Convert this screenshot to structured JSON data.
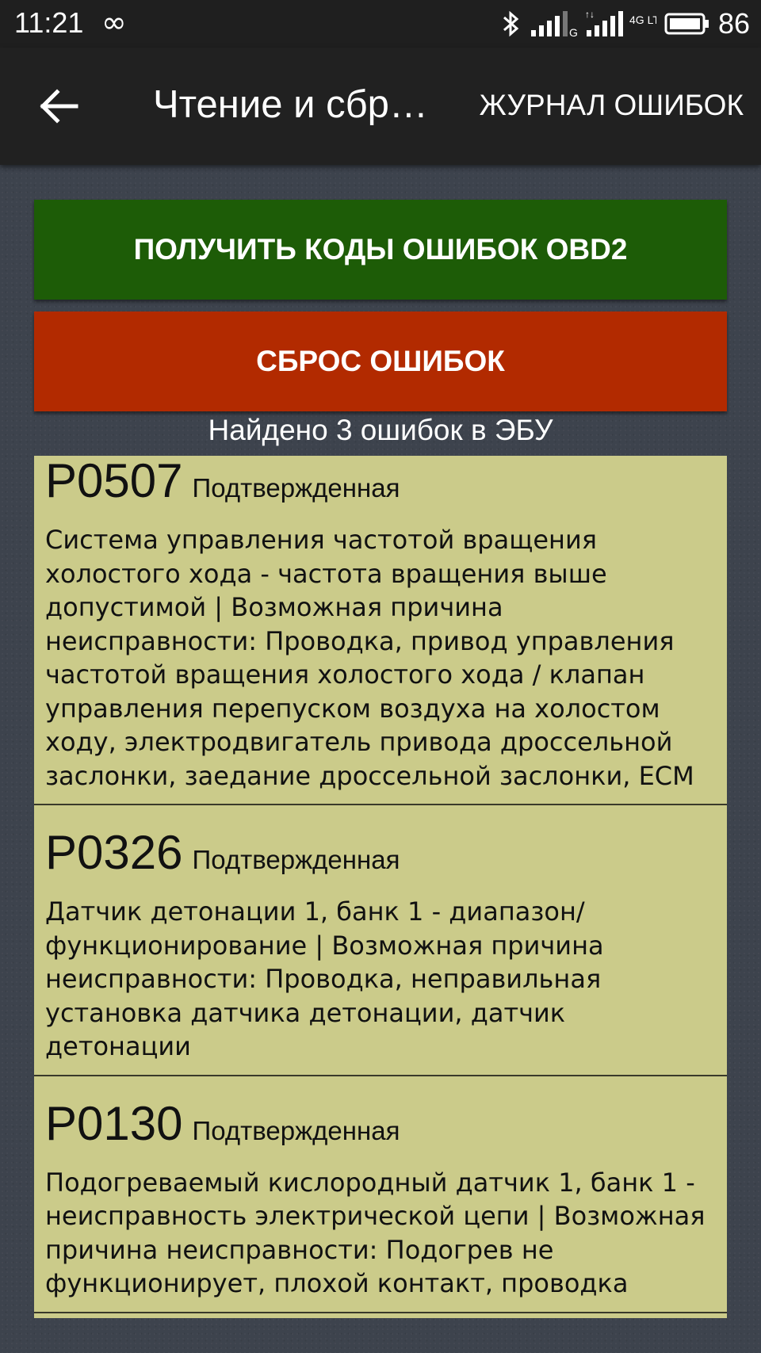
{
  "status_bar": {
    "time": "11:21",
    "infinity_symbol": "∞",
    "network": "4G LTE",
    "battery": "86"
  },
  "app_bar": {
    "title": "Чтение и сбр…",
    "log_label": "ЖУРНАЛ ОШИБОК"
  },
  "actions": {
    "get_codes_label": "ПОЛУЧИТЬ КОДЫ ОШИБОК OBD2",
    "reset_label": "СБРОС ОШИБОК"
  },
  "summary": "Найдено 3 ошибок в ЭБУ",
  "errors": [
    {
      "code": "P0507",
      "status": "Подтвержденная",
      "description": "Система управления частотой вращения холостого хода - частота вращения выше допустимой | Возможная причина неисправности: Проводка, привод управления частотой вращения холостого хода / клапан управления перепуском воздуха на холостом ходу, электродвигатель привода дроссельной заслонки, заедание дроссельной заслонки, ECM"
    },
    {
      "code": "P0326",
      "status": "Подтвержденная",
      "description": "Датчик детонации 1, банк 1 - диапазон/функционирование | Возможная причина неисправности: Проводка, неправильная установка датчика детонации, датчик детонации"
    },
    {
      "code": "P0130",
      "status": "Подтвержденная",
      "description": "Подогреваемый кислородный датчик 1, банк 1 - неисправность электрической цепи | Возможная причина неисправности: Подогрев не функционирует, плохой контакт, проводка"
    }
  ],
  "colors": {
    "get_button": "#1d5c07",
    "reset_button": "#b22a00",
    "list_background": "#cbcb8a",
    "app_bar": "#212121"
  }
}
